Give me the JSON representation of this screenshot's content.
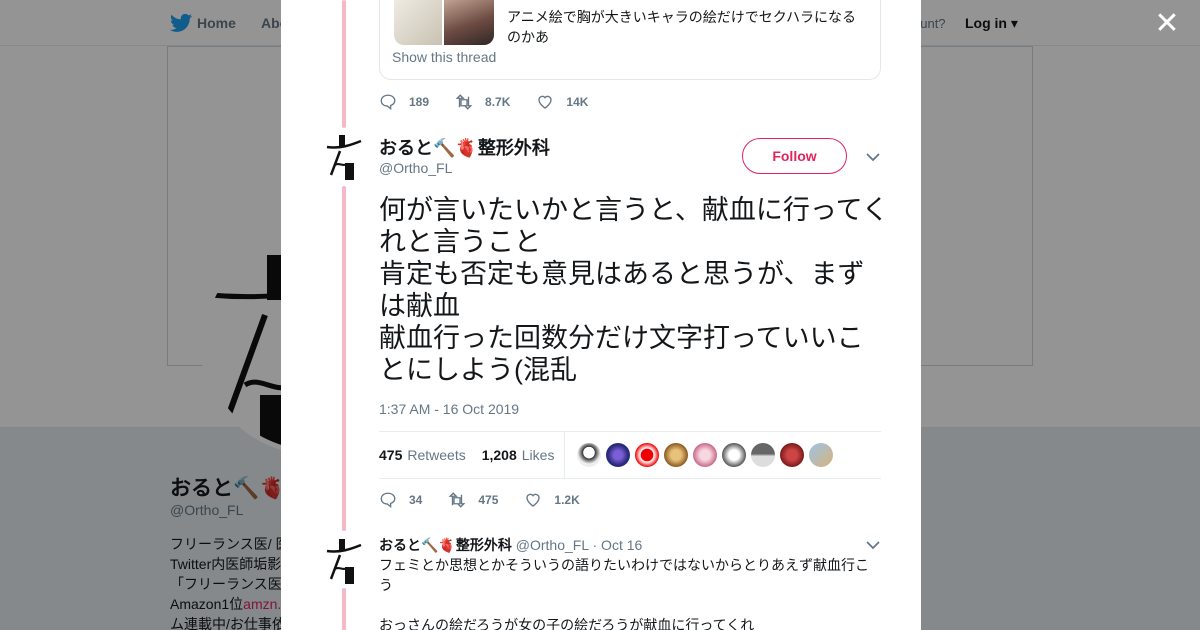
{
  "topbar": {
    "home_label": "Home",
    "about_label": "Abo",
    "account_text": "ccount?",
    "login_label": "Log in"
  },
  "profile": {
    "name": "おると🔨🫀整形外科",
    "handle": "@Ortho_FL",
    "bio_lines": [
      "フリーランス医/ 医",
      "Twitter内医師垢影",
      "「フリーランス医",
      "Amazon1位",
      "ム連載中/お仕事依"
    ],
    "bio_link": "amzn."
  },
  "quoted": {
    "text": "アニメ絵で胸が大きいキャラの絵だけでセクハラになるのかあ",
    "show_thread": "Show this thread"
  },
  "prev_actions": {
    "replies": "189",
    "retweets": "8.7K",
    "likes": "14K"
  },
  "tweet": {
    "author_name": "おると🔨🫀整形外科",
    "author_handle": "@Ortho_FL",
    "follow_label": "Follow",
    "text": "何が言いたいかと言うと、献血に行ってくれと言うこと\n肯定も否定も意見はあると思うが、まずは献血\n献血行った回数分だけ文字打っていいことにしよう(混乱",
    "timestamp": "1:37 AM - 16 Oct 2019",
    "retweets_count": "475",
    "retweets_label": "Retweets",
    "likes_count": "1,208",
    "likes_label": "Likes",
    "actions": {
      "replies": "34",
      "retweets": "475",
      "likes": "1.2K"
    }
  },
  "reply": {
    "name": "おると🔨🫀整形外科",
    "handle": "@Ortho_FL",
    "date": "· Oct 16",
    "text_line1": "フェミとか思想とかそういうの語りたいわけではないからとりあえず献血行こう",
    "text_line2": "おっさんの絵だろうが女の子の絵だろうが献血に行ってくれ"
  },
  "colors": {
    "accent": "#e0245e",
    "thread_line": "#f4b8c8",
    "muted": "#657786",
    "twitter_blue": "#1da1f2"
  },
  "icons": [
    "twitter-bird-icon",
    "close-icon",
    "reply-icon",
    "retweet-icon",
    "like-icon",
    "chevron-down-icon"
  ]
}
